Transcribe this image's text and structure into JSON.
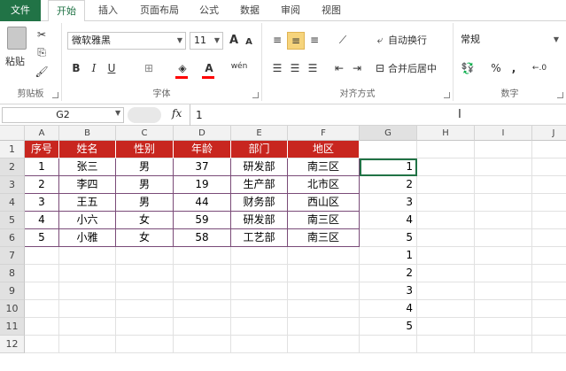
{
  "tabs": [
    "文件",
    "开始",
    "插入",
    "页面布局",
    "公式",
    "数据",
    "审阅",
    "视图"
  ],
  "clipboard": {
    "paste_label": "粘贴",
    "group_label": "剪贴板"
  },
  "font": {
    "name": "微软雅黑",
    "size": "11",
    "group_label": "字体",
    "bold": "B",
    "italic": "I",
    "underline": "U",
    "grow": "A",
    "shrink": "A",
    "color_a": "A",
    "wen": "wén"
  },
  "alignment": {
    "wrap_label": "自动换行",
    "merge_label": "合并后居中",
    "group_label": "对齐方式"
  },
  "number": {
    "format": "常规",
    "group_label": "数字",
    "percent": "%",
    "comma": ","
  },
  "formula_bar": {
    "name_box": "G2",
    "fx": "fx",
    "value": "1"
  },
  "columns": [
    "A",
    "B",
    "C",
    "D",
    "E",
    "F",
    "G",
    "H",
    "I",
    "J"
  ],
  "rows": [
    "1",
    "2",
    "3",
    "4",
    "5",
    "6",
    "7",
    "8",
    "9",
    "10",
    "11",
    "12"
  ],
  "table": {
    "headers": [
      "序号",
      "姓名",
      "性别",
      "年龄",
      "部门",
      "地区"
    ],
    "body": [
      [
        "1",
        "张三",
        "男",
        "37",
        "研发部",
        "南三区"
      ],
      [
        "2",
        "李四",
        "男",
        "19",
        "生产部",
        "北市区"
      ],
      [
        "3",
        "王五",
        "男",
        "44",
        "财务部",
        "西山区"
      ],
      [
        "4",
        "小六",
        "女",
        "59",
        "研发部",
        "南三区"
      ],
      [
        "5",
        "小雅",
        "女",
        "58",
        "工艺部",
        "南三区"
      ]
    ]
  },
  "g_values": [
    "1",
    "2",
    "3",
    "4",
    "5",
    "1",
    "2",
    "3",
    "4",
    "5"
  ],
  "colors": {
    "accent": "#217346",
    "header_red": "#c8261f",
    "highlight": "#f6d47c"
  }
}
